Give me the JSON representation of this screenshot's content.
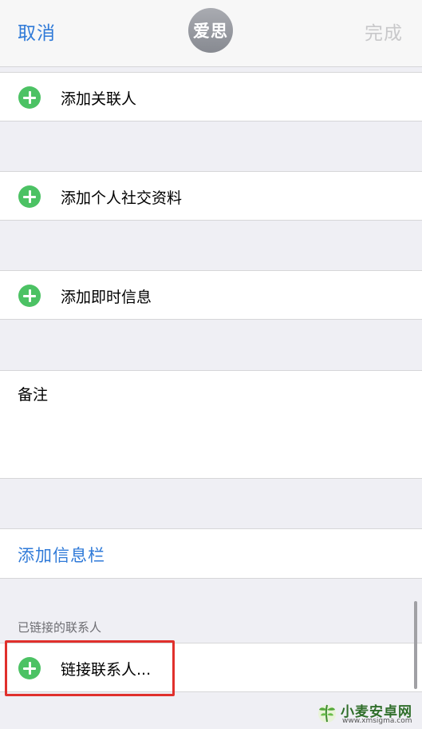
{
  "nav": {
    "cancel_label": "取消",
    "avatar_text": "爱思",
    "done_label": "完成"
  },
  "rows": {
    "add_related": "添加关联人",
    "add_social_profile": "添加个人社交资料",
    "add_instant_message": "添加即时信息"
  },
  "notes": {
    "label": "备注"
  },
  "add_field": {
    "label": "添加信息栏"
  },
  "linked_contacts": {
    "header": "已链接的联系人",
    "link_label": "链接联系人..."
  },
  "watermark": {
    "name": "小麦安卓网",
    "url": "www.xmsigma.com"
  },
  "colors": {
    "accent_blue": "#2f7ad8",
    "add_green": "#4cc264",
    "done_disabled": "#c8c8ca",
    "highlight_red": "#e0302c",
    "group_background": "#efeff4"
  }
}
